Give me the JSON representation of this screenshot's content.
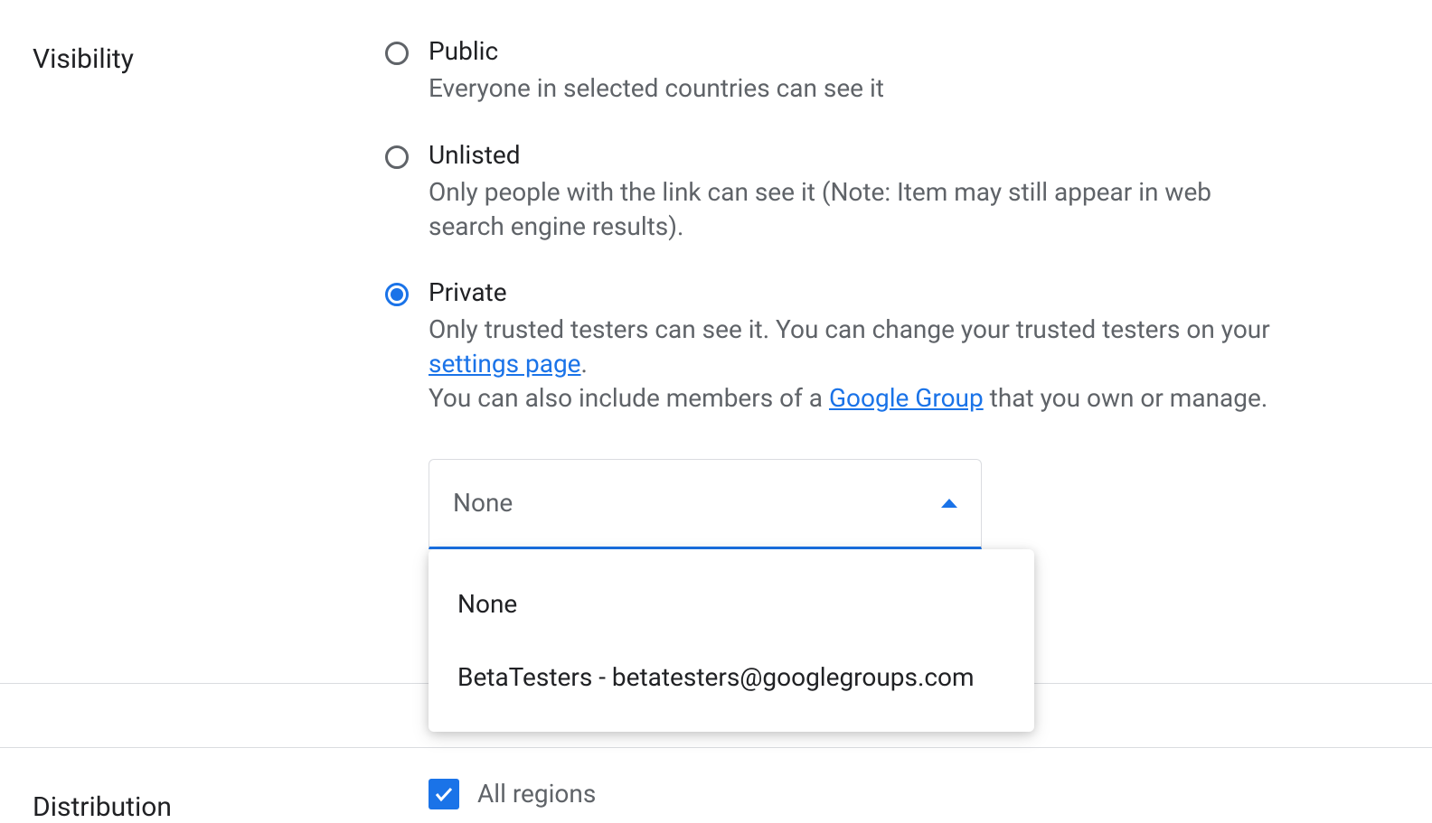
{
  "visibility": {
    "label": "Visibility",
    "options": [
      {
        "title": "Public",
        "description": "Everyone in selected countries can see it",
        "selected": false
      },
      {
        "title": "Unlisted",
        "description": "Only people with the link can see it (Note: Item may still appear in web search engine results).",
        "selected": false
      },
      {
        "title": "Private",
        "desc_part1": "Only trusted testers can see it. You can change your trusted testers on your ",
        "link1_text": "settings page",
        "desc_part2": ".",
        "desc_part3": "You can also include members of a ",
        "link2_text": "Google Group",
        "desc_part4": " that you own or manage.",
        "selected": true
      }
    ],
    "select": {
      "value": "None",
      "options": [
        "None",
        "BetaTesters - betatesters@googlegroups.com"
      ]
    }
  },
  "distribution": {
    "label": "Distribution",
    "checkbox_label": "All regions",
    "checked": true
  }
}
